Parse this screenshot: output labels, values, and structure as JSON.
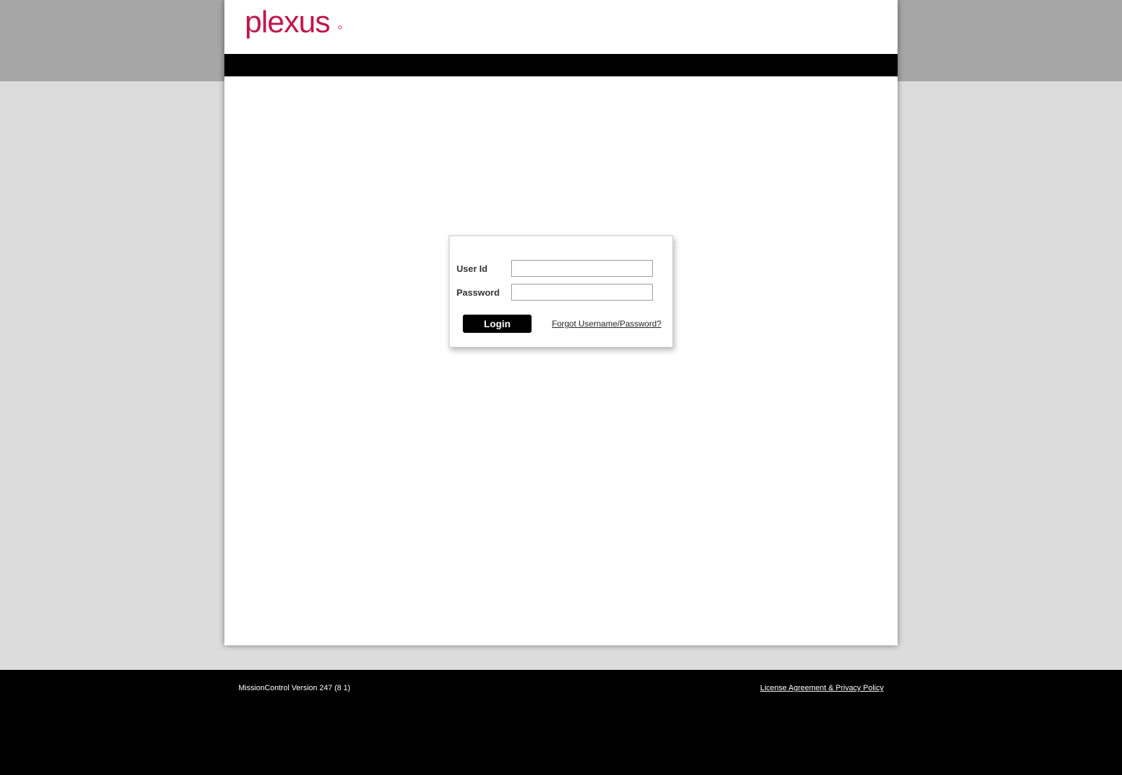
{
  "brand": {
    "name": "plexus",
    "color": "#c0174a"
  },
  "login_form": {
    "user_id_label": "User Id",
    "user_id_value": "",
    "password_label": "Password",
    "password_value": "",
    "login_button_label": "Login",
    "forgot_link_label": "Forgot Username/Password?"
  },
  "footer": {
    "version_text": "MissionControl Version 247 (8 1)",
    "license_link_label": "License Agreement & Privacy Policy"
  }
}
